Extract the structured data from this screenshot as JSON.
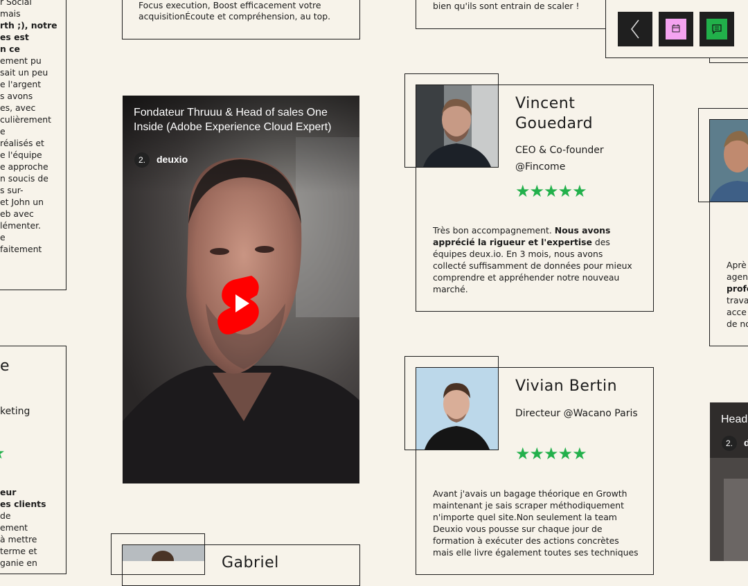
{
  "left_col": {
    "top_card_lines": [
      "r Social",
      "mais",
      "rth ;), notre",
      "es est",
      "n ce",
      "ement pu",
      "sait un peu",
      "e l'argent",
      "s avons",
      "es, avec",
      "culièrement",
      "e",
      "réalisés et",
      "e l'équipe",
      "e approche",
      "n soucis de",
      "s sur-",
      "et John un",
      "eb avec",
      "lémenter.",
      "e",
      "faitement"
    ],
    "bottom_card_lines": [
      "e",
      "keting"
    ],
    "bottom_review_lines": [
      "eur",
      "es clients",
      "de",
      "ement",
      "à mettre",
      "terme et",
      "ganie en"
    ]
  },
  "top_cards": {
    "middle_text_1": "Focus execution, Boost efficacement votre",
    "middle_text_2": "acquisitionÉcoute et compréhension, au top.",
    "right_text": "bien qu'ils sont entrain de scaler !"
  },
  "video_main": {
    "title": "Fondateur Thruuu & Head of sales One Inside (Adobe Experience Cloud Expert)",
    "badge": "2.",
    "channel": "deuxio"
  },
  "testimonial_vincent": {
    "name": "Vincent Gouedard",
    "role": "CEO & Co-founder @Fincome",
    "stars": "★★★★★",
    "review_pre": "Très bon accompagnement. ",
    "review_bold_1": "Nous avons apprécié la rigueur et l'expertise",
    "review_post": " des équipes deux.io. En 3 mois, nous avons collecté suffisamment de données pour mieux comprendre et appréhender notre nouveau marché."
  },
  "testimonial_vivian": {
    "name": "Vivian Bertin",
    "role": "Directeur @Wacano Paris",
    "stars": "★★★★★",
    "review": "Avant j'avais un bagage théorique en Growth maintenant je sais scraper méthodiquement n'importe quel site.Non seulement la team Deuxio vous pousse sur chaque jour de formation à exécuter des actions  concrètes mais elle livre également toutes ses techniques"
  },
  "bottom_card": {
    "name_partial": "Gabriel"
  },
  "right_col": {
    "review_lines": [
      "Aprè",
      "agen",
      "profe",
      "trava",
      "acce",
      "de no"
    ],
    "video_title_partial": "Head",
    "video_badge": "2.",
    "video_channel_partial": "d"
  },
  "toolbar": {
    "back_icon": "chevron-left-icon",
    "calendar_icon": "calendar-icon",
    "chat_icon": "chat-icon",
    "calendar_color": "#f4a3f0",
    "chat_color": "#21b04a"
  },
  "colors": {
    "background": "#f7f3ea",
    "star": "#22b04b",
    "play": "#ff0000"
  }
}
